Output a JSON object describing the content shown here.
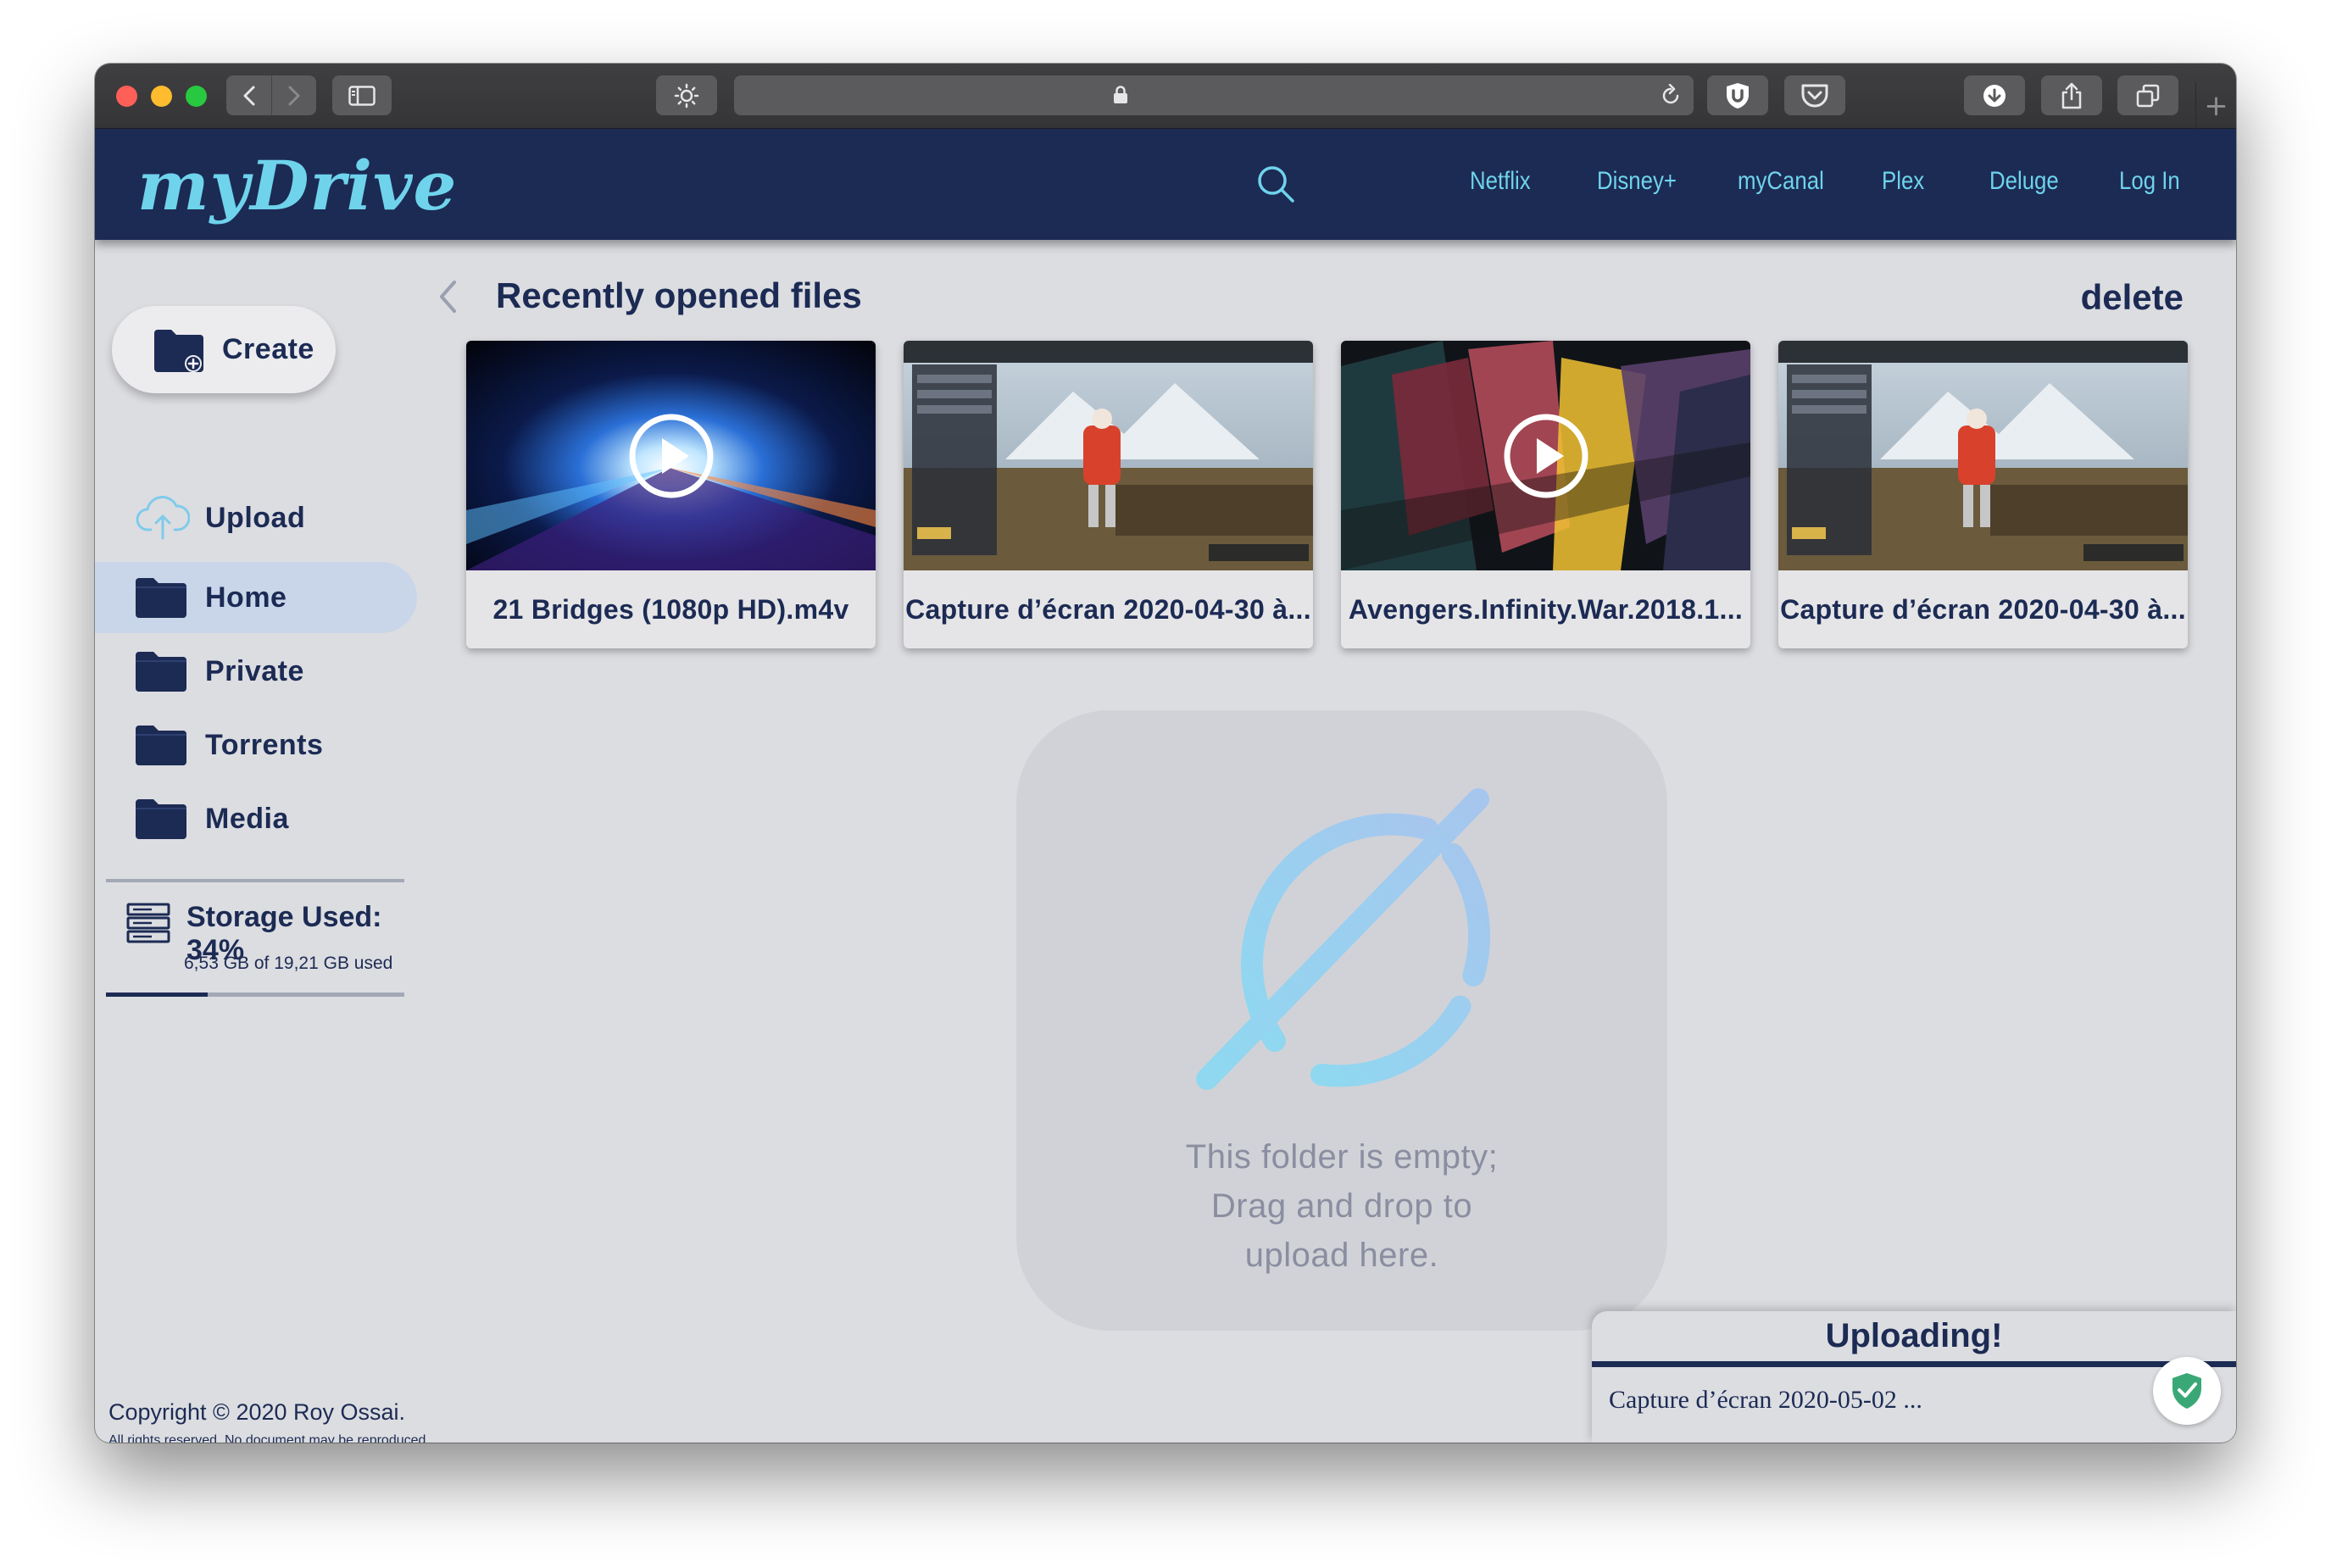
{
  "browser": {
    "address_text": "",
    "icons": [
      "back-icon",
      "forward-icon",
      "sidebar-icon",
      "brightness-icon",
      "lock-icon",
      "reload-icon",
      "ublock-icon",
      "pocket-icon",
      "download-icon",
      "share-icon",
      "tabs-icon",
      "new-tab-icon"
    ]
  },
  "header": {
    "logo": "myDrive",
    "nav": [
      "Netflix",
      "Disney+",
      "myCanal",
      "Plex",
      "Deluge",
      "Log In"
    ]
  },
  "sidebar": {
    "create_label": "Create",
    "items": [
      {
        "label": "Upload",
        "icon": "cloud-upload-icon"
      },
      {
        "label": "Home",
        "icon": "folder-icon",
        "active": true
      },
      {
        "label": "Private",
        "icon": "folder-icon"
      },
      {
        "label": "Torrents",
        "icon": "folder-icon"
      },
      {
        "label": "Media",
        "icon": "folder-icon"
      }
    ],
    "storage": {
      "title": "Storage Used: 34%",
      "detail": "6,53 GB of 19,21 GB used",
      "percent": 34
    },
    "copyright": {
      "line1": "Copyright © 2020 Roy Ossai.",
      "line2": "All rights reserved. No document may be reproduced for commercial use without written approval from the author."
    }
  },
  "main": {
    "section_title": "Recently opened files",
    "delete_label": "delete",
    "files": [
      {
        "name": "21 Bridges (1080p HD).m4v",
        "type": "video"
      },
      {
        "name": "Capture d’écran 2020-04-30 à...",
        "type": "image"
      },
      {
        "name": "Avengers.Infinity.War.2018.1...",
        "type": "video"
      },
      {
        "name": "Capture d’écran 2020-04-30 à...",
        "type": "image"
      }
    ],
    "empty": {
      "line1": "This folder is empty;",
      "line2": "Drag and drop to",
      "line3": "upload here."
    }
  },
  "upload": {
    "title": "Uploading!",
    "file": "Capture d’écran 2020-05-02 ..."
  },
  "colors": {
    "navy": "#1c2b54",
    "accent": "#6fd3ec",
    "panel": "#dcdde1",
    "success": "#3aa876"
  }
}
